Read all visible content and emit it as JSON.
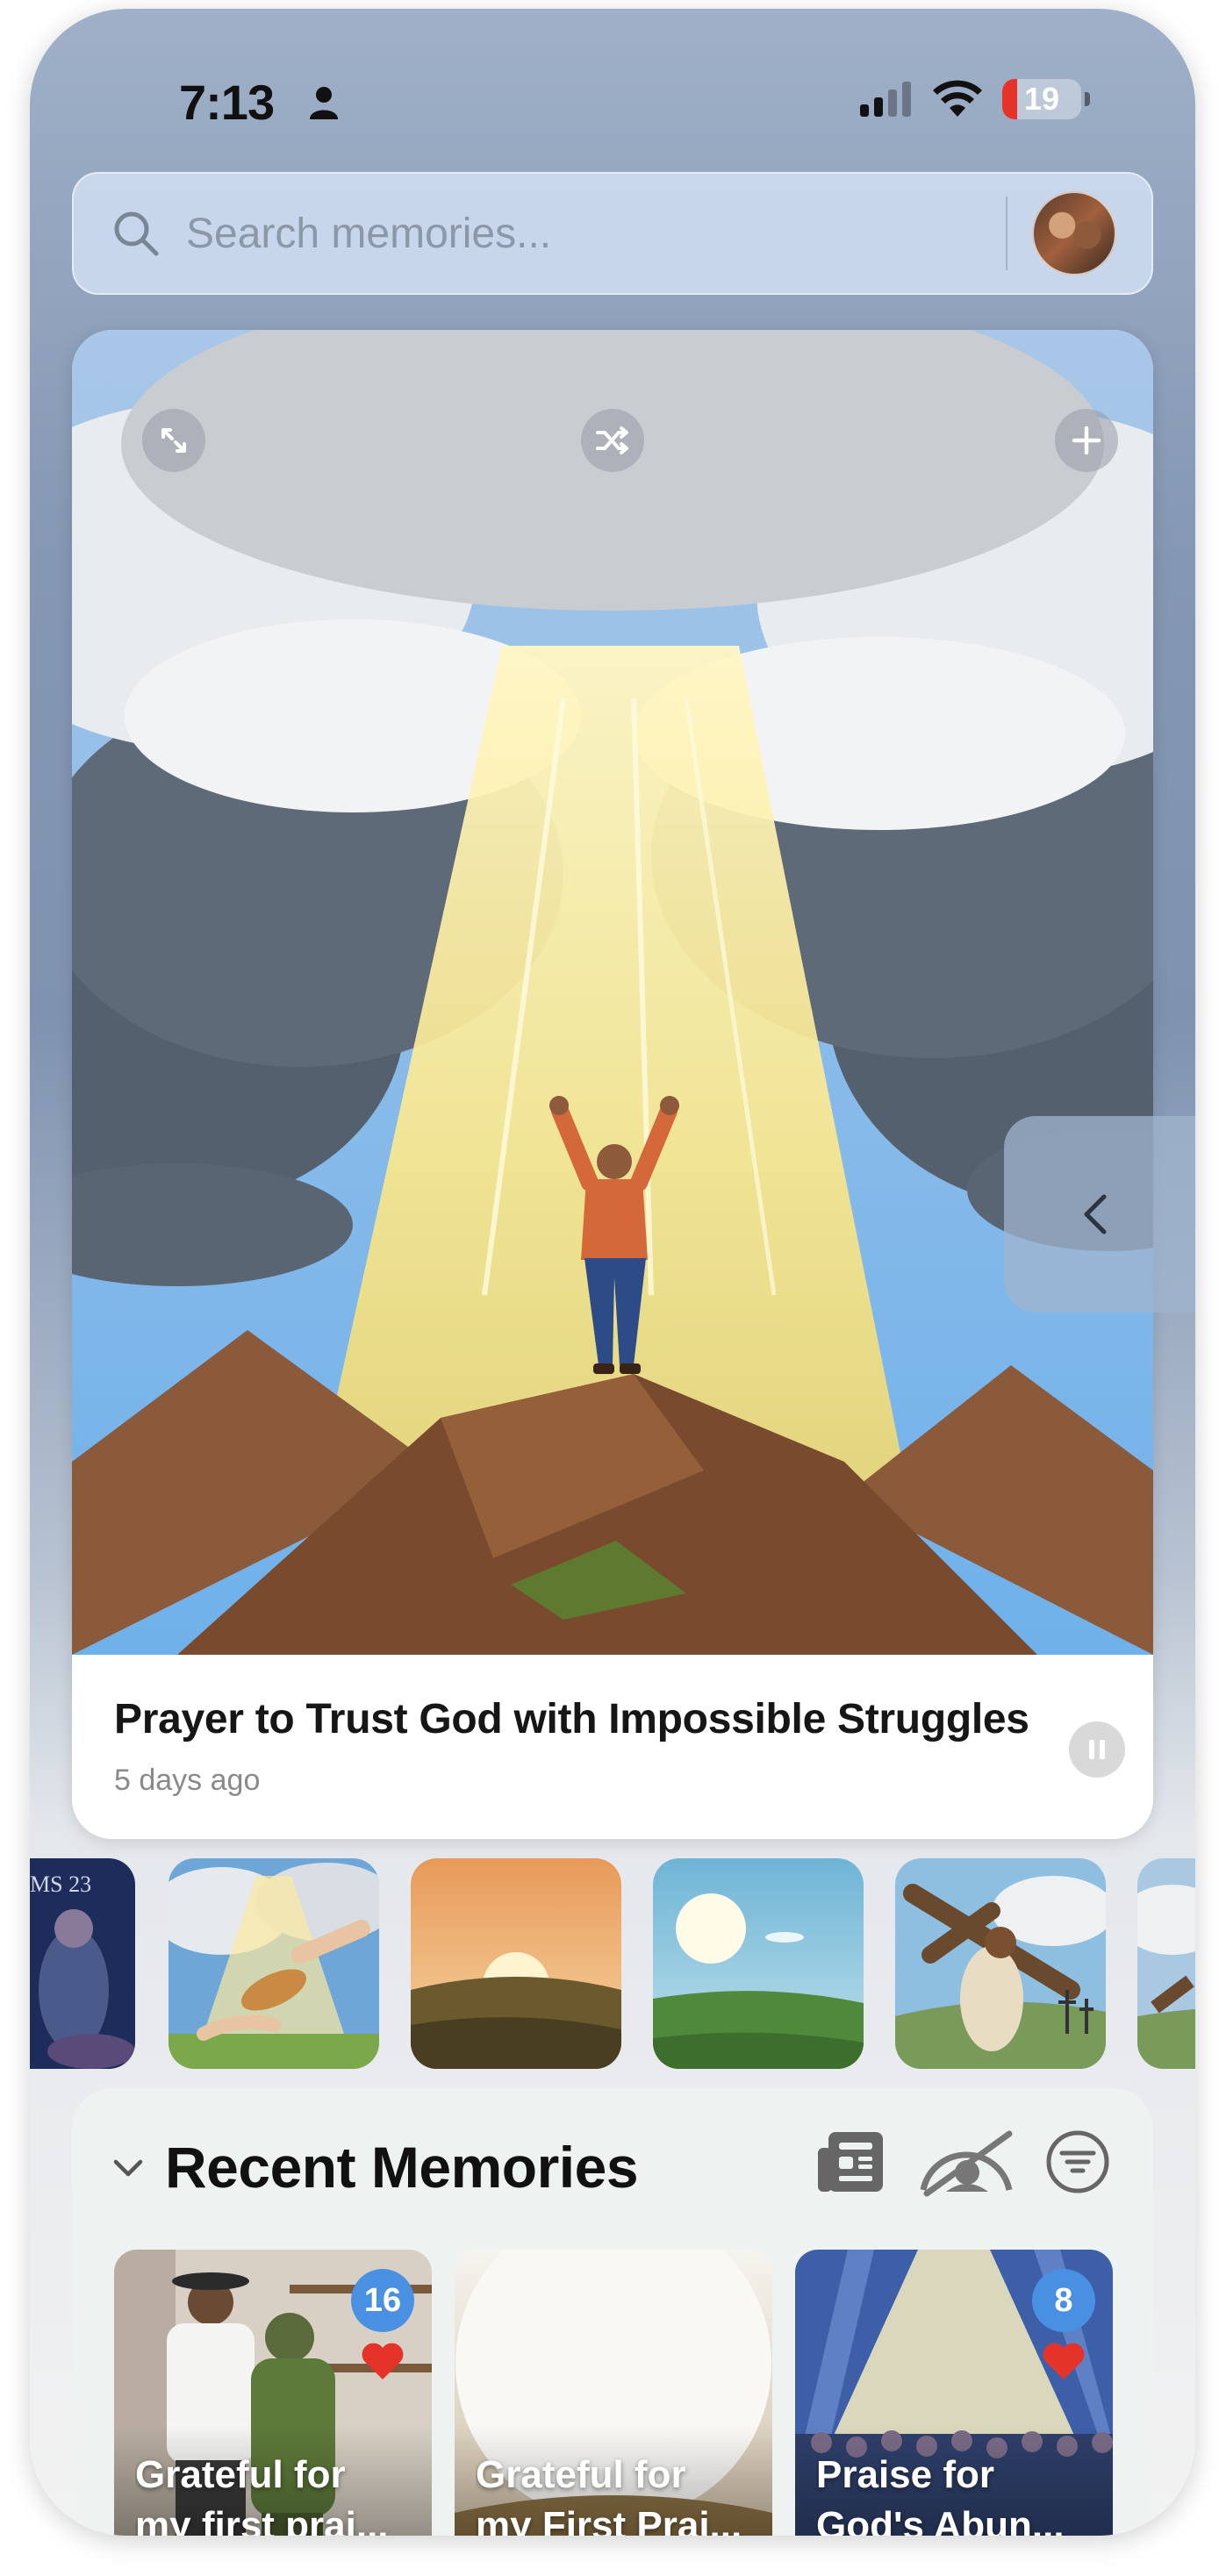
{
  "status_bar": {
    "time": "7:13",
    "battery_level": "19",
    "battery_fraction": 0.19
  },
  "search": {
    "placeholder": "Search memories..."
  },
  "hero": {
    "title": "Prayer to Trust God with Impossible Struggles",
    "timestamp": "5 days ago",
    "buttons": [
      "expand-icon",
      "shuffle-icon",
      "plus-icon"
    ],
    "playback_button": "pause-icon"
  },
  "thumbnails": [
    {
      "name": "psalms-23-thumbnail",
      "caption_fragment": "MS 23"
    },
    {
      "name": "bread-offering-thumbnail"
    },
    {
      "name": "sunset-thumbnail"
    },
    {
      "name": "green-hills-thumbnail"
    },
    {
      "name": "jesus-cross-thumbnail"
    },
    {
      "name": "partial-thumbnail"
    }
  ],
  "recent": {
    "title": "Recent Memories",
    "actions": [
      "newspaper-icon",
      "hidden-icon",
      "filter-icon"
    ],
    "cards": [
      {
        "line1": "Grateful for",
        "line2": "my first prai...",
        "badge": "16",
        "favorite": true
      },
      {
        "line1": "Grateful for",
        "line2": "my First Prai...",
        "badge": "",
        "favorite": false
      },
      {
        "line1": "Praise for",
        "line2": "God's Abun...",
        "badge": "8",
        "favorite": true
      }
    ]
  },
  "colors": {
    "accent_blue": "#4a90e2",
    "favorite_red": "#e5332a",
    "battery_red": "#e5332a"
  }
}
